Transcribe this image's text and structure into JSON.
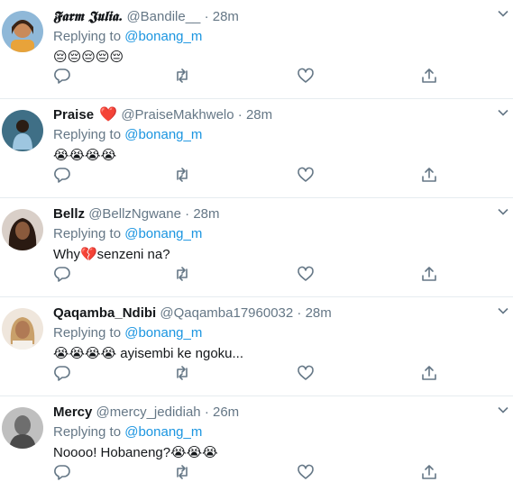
{
  "reply_prefix": "Replying to",
  "colors": {
    "accent": "#1b95e0",
    "muted": "#657786",
    "text": "#14171a",
    "heart": "#e0245e"
  },
  "icons": {
    "reply": "reply-icon",
    "retweet": "retweet-icon",
    "like": "like-icon",
    "share": "share-icon",
    "more": "chevron-down-icon"
  },
  "tweets": [
    {
      "name": "𝕱𝖆𝖗𝖒 𝕵𝖚𝖑𝖎𝖆.",
      "handle": "@Bandile__",
      "time": "28m",
      "reply_to": "@bonang_m",
      "text": "😔😔😔😔😔"
    },
    {
      "name": "Praise",
      "badge": "❤️",
      "handle": "@PraiseMakhwelo",
      "time": "28m",
      "reply_to": "@bonang_m",
      "text": "😭😭😭😭"
    },
    {
      "name": "Bellz",
      "handle": "@BellzNgwane",
      "time": "28m",
      "reply_to": "@bonang_m",
      "text": "Why💔senzeni na?"
    },
    {
      "name": "Qaqamba_Ndibi",
      "handle": "@Qaqamba17960032",
      "time": "28m",
      "reply_to": "@bonang_m",
      "text": "😭😭😭😭 ayisembi ke ngoku..."
    },
    {
      "name": "Mercy",
      "handle": "@mercy_jedidiah",
      "time": "26m",
      "reply_to": "@bonang_m",
      "text": "Noooo! Hobaneng?😭😭😭"
    }
  ]
}
